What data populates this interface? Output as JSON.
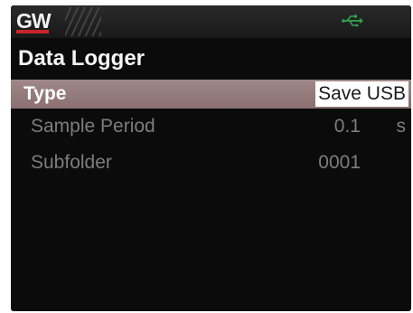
{
  "status": {
    "logo": "GW",
    "usb_icon": "usb-icon",
    "usb_color": "#2fa84f"
  },
  "title": "Data Logger",
  "settings": [
    {
      "label": "Type",
      "value": "Save USB",
      "unit": ""
    },
    {
      "label": "Sample Period",
      "value": "0.1",
      "unit": "s"
    },
    {
      "label": "Subfolder",
      "value": "0001",
      "unit": ""
    }
  ],
  "colors": {
    "selection_bar": "#8a7070",
    "logo_accent": "#c8242c"
  }
}
